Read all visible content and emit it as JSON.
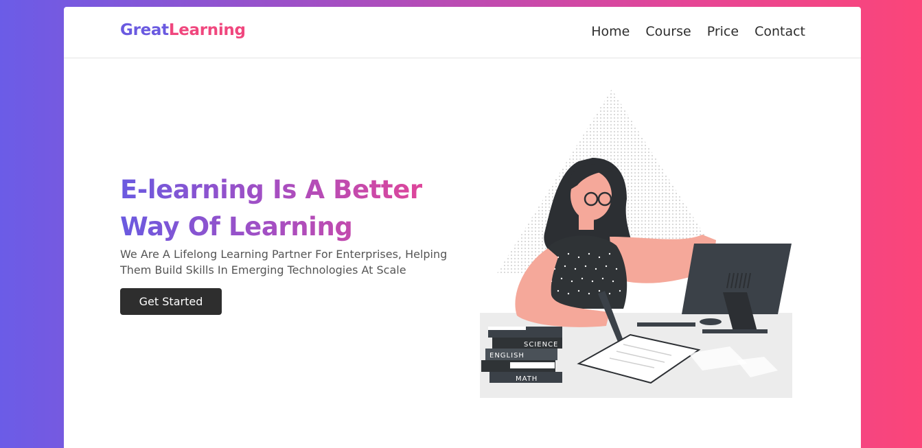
{
  "brand": {
    "part1": "Great",
    "part2": "Learning"
  },
  "nav": {
    "items": [
      "Home",
      "Course",
      "Price",
      "Contact"
    ]
  },
  "hero": {
    "title_line1": "E-learning Is A Better",
    "title_line2": "Way Of Learning",
    "subtitle_line1": "We Are A Lifelong Learning Partner For Enterprises, Helping",
    "subtitle_line2": "Them Build Skills In Emerging Technologies At Scale",
    "cta_label": "Get Started"
  },
  "illustration": {
    "books": [
      "SCIENCE",
      "ENGLISH",
      "MATH"
    ]
  },
  "colors": {
    "brand_primary": "#6a5ae0",
    "brand_accent": "#f0477e",
    "cta_bg": "#2e2e2e"
  }
}
